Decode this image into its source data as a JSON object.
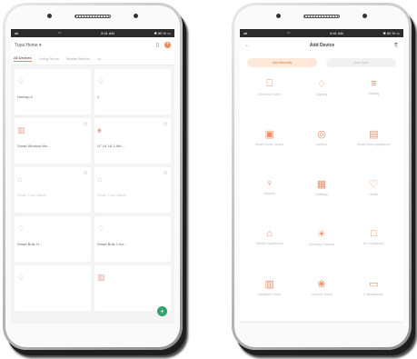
{
  "status": {
    "signal": "atl",
    "wifi": "◠",
    "time": "9:41 AM",
    "battery": "✱ 60 % ▭"
  },
  "left": {
    "home_label": "Tuya Home ▾",
    "tabs": [
      "All Devices",
      "Living Room",
      "Master Bedroo",
      "•••"
    ],
    "devices": [
      {
        "icon": "bulb-icon",
        "glyph": "♢",
        "name": "Hemisp.0",
        "status": "",
        "on": true
      },
      {
        "icon": "bulb-icon",
        "glyph": "♢",
        "name": "1",
        "status": "",
        "on": true
      },
      {
        "icon": "switch-icon",
        "glyph": "▥",
        "name": "Smart Window Ma...",
        "status": "",
        "on": true
      },
      {
        "icon": "lamp-icon",
        "glyph": "♠",
        "name": "LF LK 16.1 Ath...",
        "status": "",
        "on": true
      },
      {
        "icon": "plug-icon",
        "glyph": "⌂",
        "name": "Smart Gate Mach...",
        "status": "",
        "on": false
      },
      {
        "icon": "plug-icon",
        "glyph": "⌂",
        "name": "Smart Gate Mach...",
        "status": "",
        "on": false
      },
      {
        "icon": "bulb-icon",
        "glyph": "♢",
        "name": "Smart Bulb H...",
        "status": "",
        "on": true
      },
      {
        "icon": "bulb-icon",
        "glyph": "♢",
        "name": "Smart Bulb 1 for...",
        "status": "",
        "on": true
      },
      {
        "icon": "bulb-icon",
        "glyph": "♢",
        "name": "",
        "status": "",
        "on": true
      },
      {
        "icon": "switch-icon",
        "glyph": "▥",
        "name": "",
        "status": "",
        "on": true
      }
    ],
    "fab": "+"
  },
  "right": {
    "back": "←",
    "title": "Add Device",
    "scan": "⎘",
    "segments": [
      "Add Manually",
      "Auto Scan"
    ],
    "devices": [
      {
        "icon": "socket-icon",
        "glyph": "⎕",
        "label": "Electrical Outlet"
      },
      {
        "icon": "bulb-icon",
        "glyph": "♢",
        "label": "Lighting"
      },
      {
        "icon": "heater-icon",
        "glyph": "≡",
        "label": "Heating"
      },
      {
        "icon": "sensor-icon",
        "glyph": "▣",
        "label": "Smart Home Sensor"
      },
      {
        "icon": "camera-icon",
        "glyph": "◎",
        "label": "Camera"
      },
      {
        "icon": "appliance-icon",
        "glyph": "▤",
        "label": "Small Home Appliances"
      },
      {
        "icon": "thermo-icon",
        "glyph": "♀",
        "label": "Security"
      },
      {
        "icon": "gate-icon",
        "glyph": "▦",
        "label": "Gateway"
      },
      {
        "icon": "heart-icon",
        "glyph": "♡",
        "label": "Health"
      },
      {
        "icon": "kitchen-icon",
        "glyph": "⌂",
        "label": "Kitchen Appliances"
      },
      {
        "icon": "cleaner-icon",
        "glyph": "☀",
        "label": "Cleaning Products"
      },
      {
        "icon": "hvac-icon",
        "glyph": "□",
        "label": "Air Conditioner"
      },
      {
        "icon": "curtain-icon",
        "glyph": "▥",
        "label": "Intelligent Panel"
      },
      {
        "icon": "outdoor-icon",
        "glyph": "❀",
        "label": "Outdoor Travel"
      },
      {
        "icon": "other-icon",
        "glyph": "▭",
        "label": "Entertainment"
      }
    ]
  }
}
